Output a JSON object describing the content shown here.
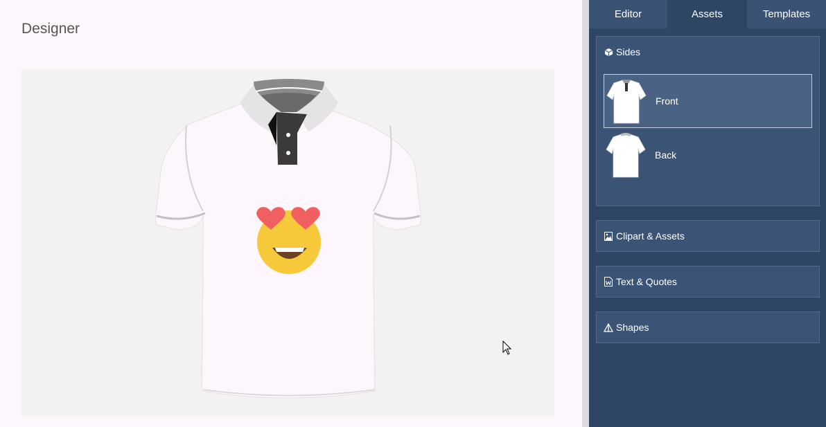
{
  "designer": {
    "title": "Designer"
  },
  "tabs": [
    {
      "label": "Editor",
      "active": false
    },
    {
      "label": "Assets",
      "active": true
    },
    {
      "label": "Templates",
      "active": false
    }
  ],
  "sides": {
    "title": "Sides",
    "icon": "cube-icon",
    "items": [
      {
        "label": "Front",
        "selected": true
      },
      {
        "label": "Back",
        "selected": false
      }
    ]
  },
  "sections": {
    "clipart": {
      "title": "Clipart & Assets",
      "icon": "image-icon"
    },
    "text": {
      "title": "Text & Quotes",
      "icon": "word-file-icon"
    },
    "shapes": {
      "title": "Shapes",
      "icon": "triangle-icon"
    }
  },
  "colors": {
    "panel": "#2e4664",
    "section": "#3b5476",
    "canvas": "#f2f2f1",
    "shirt": "#fdf7fd",
    "emoji_face": "#f5c93a",
    "emoji_heart": "#f06060"
  }
}
